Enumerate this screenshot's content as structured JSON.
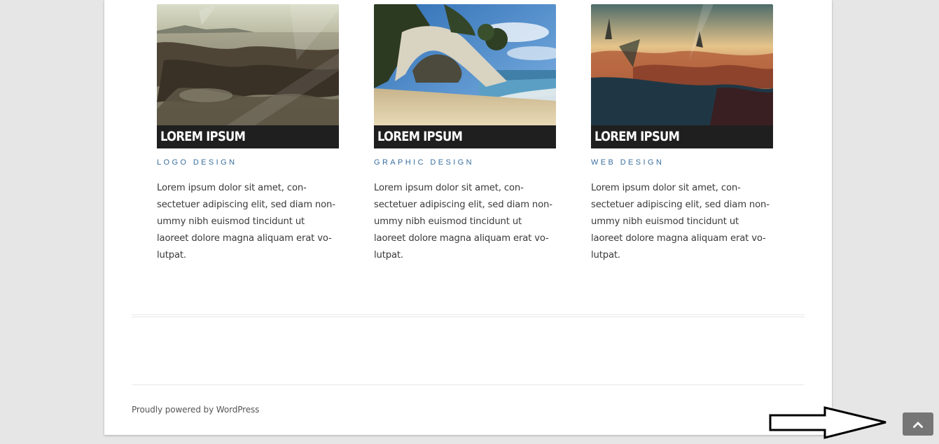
{
  "cards": [
    {
      "title": "LOREM IPSUM",
      "category": "LOGO DESIGN",
      "excerpt": "Lorem ipsum dolor sit amet, con-\nsectetuer adipiscing elit, sed diam non-\nummy nibh euismod tincidunt ut\nlaoreet dolore magna aliquam erat vo-\nlutpat."
    },
    {
      "title": "LOREM IPSUM",
      "category": "GRAPHIC DESIGN",
      "excerpt": "Lorem ipsum dolor sit amet, con-\nsectetuer adipiscing elit, sed diam non-\nummy nibh euismod tincidunt ut\nlaoreet dolore magna aliquam erat vo-\nlutpat."
    },
    {
      "title": "LOREM IPSUM",
      "category": "WEB DESIGN",
      "excerpt": "Lorem ipsum dolor sit amet, con-\nsectetuer adipiscing elit, sed diam non-\nummy nibh euismod tincidunt ut\nlaoreet dolore magna aliquam erat vo-\nlutpat."
    }
  ],
  "footer": {
    "credit": "Proudly powered by WordPress"
  },
  "back_to_top": {
    "icon": "chevron-up-icon"
  },
  "colors": {
    "background": "#e6e6e6",
    "page": "#ffffff",
    "title_bar": "#1f1f1f",
    "category": "#3a6f9e",
    "back_to_top": "#767676"
  }
}
